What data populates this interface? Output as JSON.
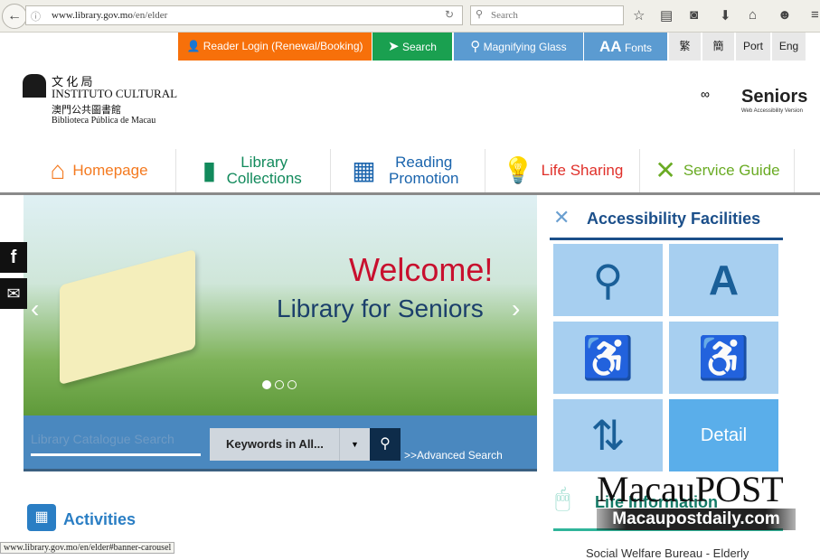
{
  "browser": {
    "url_domain": "www.library.gov.mo",
    "url_path": "/en/elder",
    "search_placeholder": "Search",
    "status_url": "www.library.gov.mo/en/elder#banner-carousel"
  },
  "topbar": [
    {
      "label": "Reader Login (Renewal/Booking)",
      "color": "#f7700a",
      "icon": "user-icon"
    },
    {
      "label": "Search",
      "color": "#1aa050",
      "icon": "navigation-arrow-icon"
    },
    {
      "label": "Magnifying Glass",
      "color": "#5b9bd1",
      "icon": "magnifier-icon"
    },
    {
      "label": "Fonts",
      "color": "#5b9bd1",
      "icon": "font-size-icon",
      "icon_text": "AA"
    }
  ],
  "languages": [
    "繁",
    "簡",
    "Port",
    "Eng"
  ],
  "logo": {
    "zh": "文 化 局",
    "pt": "INSTITUTO CULTURAL",
    "lib_zh": "澳門公共圖書館",
    "lib_pt": "Biblioteca Pública de Macau"
  },
  "seniors": {
    "title": "Seniors",
    "subtitle": "Web Accessibility Version"
  },
  "nav": [
    {
      "label": "Homepage",
      "color": "#f47a20"
    },
    {
      "label": "Library Collections",
      "color": "#128a5c"
    },
    {
      "label": "Reading Promotion",
      "color": "#1a64ad"
    },
    {
      "label": "Life Sharing",
      "color": "#e0302a"
    },
    {
      "label": "Service Guide",
      "color": "#6aab24"
    }
  ],
  "banner": {
    "welcome": "Welcome!",
    "subtitle": "Library for Seniors",
    "slides": 3,
    "active_slide": 1
  },
  "catalogue": {
    "placeholder": "Library Catalogue Search",
    "scope": "Keywords in All...",
    "advanced": ">>Advanced Search"
  },
  "accessibility": {
    "title": "Accessibility Facilities",
    "detail": "Detail"
  },
  "life": {
    "title": "Life Information",
    "item": "Social Welfare Bureau - Elderly"
  },
  "activities": {
    "title": "Activities"
  },
  "watermark": {
    "brand": "The Macau POST Daily",
    "site": "Macaupostdaily.com"
  }
}
